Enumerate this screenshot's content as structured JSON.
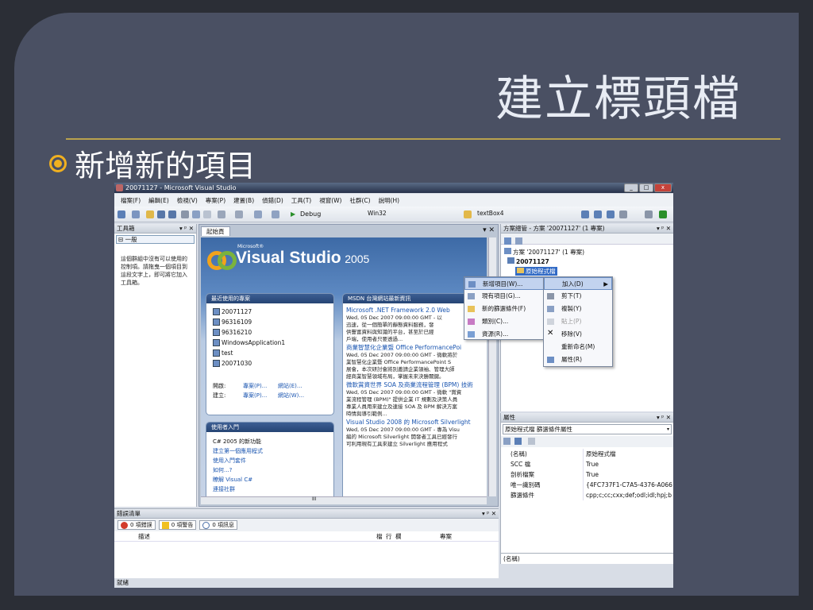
{
  "slide": {
    "title": "建立標頭檔",
    "bullet": "新增新的項目"
  },
  "window": {
    "title": "20071127 - Microsoft Visual Studio",
    "minimize": "_",
    "maximize": "□",
    "close": "x"
  },
  "menu": [
    "檔案(F)",
    "編輯(E)",
    "檢視(V)",
    "專案(P)",
    "建置(B)",
    "偵錯(D)",
    "工具(T)",
    "視窗(W)",
    "社群(C)",
    "說明(H)"
  ],
  "toolbar": {
    "run_arrow": "▶",
    "config": "Debug",
    "platform": "Win32",
    "find_value": "textBox4"
  },
  "toolbox": {
    "title": "工具箱",
    "controls": "▾ ᵖ ✕",
    "group": "⊟ 一般",
    "empty_text": "這個群組中沒有可以使用的控制項。請拖曳一個項目到這段文字上，即可將它加入工具箱。"
  },
  "document": {
    "tab": "起始頁",
    "close": "▾ ✕",
    "logo_ms": "Microsoft®",
    "logo_name": "Visual Studio",
    "logo_year": "2005",
    "recent": {
      "header": "最近使用的專案",
      "projects": [
        "20071127",
        "96316109",
        "96316210",
        "WindowsApplication1",
        "test",
        "20071030"
      ],
      "open_label": "開啟:",
      "open_project": "專案(P)...",
      "open_site": "網站(E)...",
      "create_label": "建立:",
      "create_project": "專案(P)...",
      "create_site": "網站(W)..."
    },
    "getting_started": {
      "header": "使用者入門",
      "items": [
        "C# 2005 的新功能",
        "建立第一個應用程式",
        "使用入門套件",
        "如何...?",
        "瞭解 Visual C#",
        "連接社群"
      ]
    },
    "msdn": {
      "header": "MSDN 台灣網站最新資訊",
      "articles": [
        {
          "title": "Microsoft .NET Framework 2.0 Web",
          "date": "Wed, 05 Dec 2007 09:00:00 GMT - 以",
          "lines": [
            "迅速，從一個簡單的靜態資料服務，發",
            "供豐富資料與知識的平台，甚至於已經",
            "戶端，使用者只要透過..."
          ]
        },
        {
          "title": "商業智慧化企業暨 Office PerformancePoi",
          "date": "Wed, 05 Dec 2007 09:00:00 GMT - 微軟將於",
          "lines": [
            "業智慧化企業暨 Office PerformancePoint S",
            "展會，本次研討會將別邀請企業領袖、管理大師",
            "經商業智慧領域布局，掌握未來決勝關鍵。"
          ]
        },
        {
          "title": "微軟賞資世界 SOA 及商業流程管理 (BPM) 技術",
          "date": "Wed, 05 Dec 2007 09:00:00 GMT - 微軟 \"賞資",
          "lines": [
            "業流程管理 (BPM)\" 提供企業 IT 規劃及決策人員",
            "專業人員用來建立及連接 SOA 及 BPM 解決方案",
            "時情與導引範例..."
          ]
        },
        {
          "title": "Visual Studio 2008 的 Microsoft Silverlight",
          "date": "Wed, 05 Dec 2007 09:00:00 GMT - 專為 Visu",
          "lines": [
            "編的 Microsoft Silverlight 開發者工具已經發行",
            "可利用現有工具來建立 Silverlight 應用程式"
          ]
        }
      ]
    },
    "hscroll_mark": "III"
  },
  "solution": {
    "title": "方案總管 - 方案 '20071127' (1 專案)",
    "controls": "▾ ᵖ ✕",
    "root": "方案 '20071127' (1 專案)",
    "project": "20071127",
    "folder": "原始程式檔"
  },
  "context_menu": {
    "items": [
      {
        "label": "新增項目(W)...",
        "highlight": true
      },
      {
        "label": "現有項目(G)...",
        "highlight": false
      },
      {
        "label": "新的篩選條件(F)",
        "highlight": false
      },
      {
        "label": "類別(C)...",
        "highlight": false
      },
      {
        "label": "資源(R)...",
        "highlight": false
      }
    ]
  },
  "folder_menu": {
    "items": [
      {
        "label": "加入(D)",
        "highlight": true,
        "disabled": false
      },
      {
        "label": "剪下(T)",
        "highlight": false,
        "disabled": false
      },
      {
        "label": "複製(Y)",
        "highlight": false,
        "disabled": false
      },
      {
        "label": "貼上(P)",
        "highlight": false,
        "disabled": true
      },
      {
        "label": "移除(V)",
        "highlight": false,
        "disabled": false
      },
      {
        "label": "重新命名(M)",
        "highlight": false,
        "disabled": false
      },
      {
        "label": "屬性(R)",
        "highlight": false,
        "disabled": false
      }
    ],
    "submenu_arrow": "▶"
  },
  "properties": {
    "title": "屬性",
    "controls": "▾ ᵖ ✕",
    "selector": "原始程式檔 篩選條件屬性",
    "rows": [
      {
        "k": "(名稱)",
        "v": "原始程式檔"
      },
      {
        "k": "SCC 檔",
        "v": "True"
      },
      {
        "k": "剖析檔案",
        "v": "True"
      },
      {
        "k": "唯一識別碼",
        "v": "{4FC737F1-C7A5-4376-A066"
      },
      {
        "k": "篩選條件",
        "v": "cpp;c;cc;cxx;def;odl;idl;hpj;b"
      }
    ],
    "desc": "(名稱)"
  },
  "errors": {
    "title": "錯誤清單",
    "controls": "▾ ᵖ ✕",
    "tab_errors": "0 項錯誤",
    "tab_warnings": "0 項警告",
    "tab_messages": "0 項訊息",
    "col_desc": "描述",
    "col_file": "檔",
    "col_line": "行",
    "col_col": "欄",
    "col_project": "專案"
  },
  "status": "就緒",
  "colors": {
    "slide_bg": "#4a5063",
    "accent_gold": "#b9a24e",
    "bullet": "#f0b020",
    "logo_orange": "#f2a31b",
    "logo_green": "#7bb33c"
  }
}
